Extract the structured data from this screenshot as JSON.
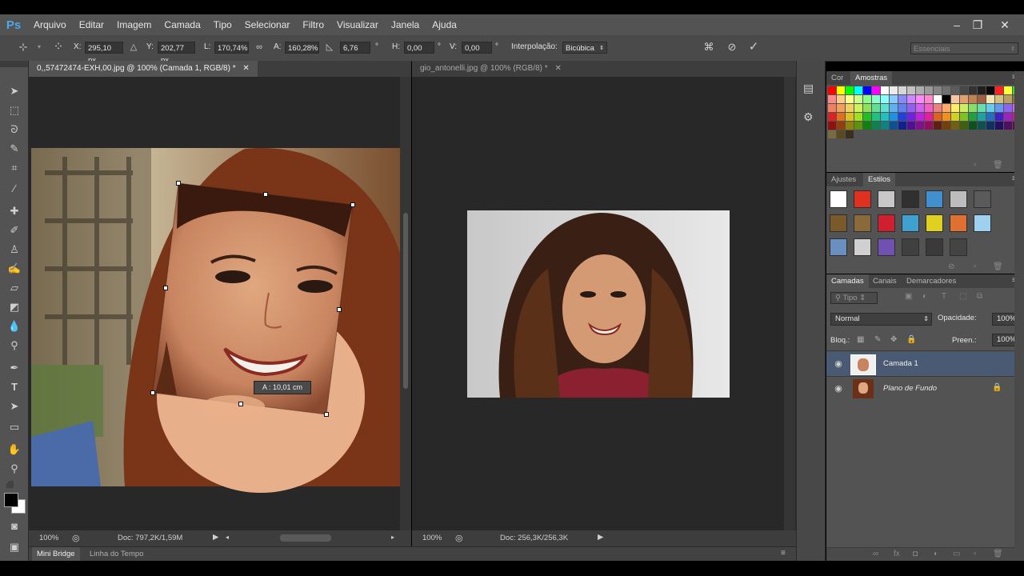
{
  "app": {
    "logo": "Ps"
  },
  "menu": [
    "Arquivo",
    "Editar",
    "Imagem",
    "Camada",
    "Tipo",
    "Selecionar",
    "Filtro",
    "Visualizar",
    "Janela",
    "Ajuda"
  ],
  "window_controls": {
    "minimize": "–",
    "restore": "❐",
    "close": "✕"
  },
  "options": {
    "x_label": "X:",
    "x_value": "295,10 px",
    "y_label": "Y:",
    "y_value": "202,77 px",
    "w_label": "L:",
    "w_value": "170,74%",
    "h_label": "A:",
    "h_value": "160,28%",
    "angle_value": "6,76",
    "hskew_label": "H:",
    "hskew_value": "0,00",
    "vskew_label": "V:",
    "vskew_value": "0,00",
    "degree": "°",
    "interp_label": "Interpolação:",
    "interp_value": "Bicúbica",
    "workspace": "Essenciais"
  },
  "doc1": {
    "tab": "0,,57472474-EXH,00.jpg @ 100% (Camada 1, RGB/8) *",
    "zoom": "100%",
    "doc_info": "Doc: 797,2K/1,59M",
    "transform_tooltip": "A :  10,01 cm"
  },
  "doc2": {
    "tab": "gio_antonelli.jpg @ 100% (RGB/8) *",
    "zoom": "100%",
    "doc_info": "Doc: 256,3K/256,3K"
  },
  "bottom_tabs": {
    "mini_bridge": "Mini Bridge",
    "timeline": "Linha do Tempo"
  },
  "color_panel": {
    "tab_color": "Cor",
    "tab_swatches": "Amostras"
  },
  "styles_panel": {
    "tab_adjust": "Ajustes",
    "tab_styles": "Estilos"
  },
  "layers_panel": {
    "tab_layers": "Camadas",
    "tab_channels": "Canais",
    "tab_paths": "Demarcadores",
    "kind_filter": "Tipo",
    "blend_mode": "Normal",
    "opacity_label": "Opacidade:",
    "opacity_value": "100%",
    "lock_label": "Bloq.:",
    "fill_label": "Preen.:",
    "fill_value": "100%",
    "layers": [
      {
        "name": "Camada 1",
        "selected": true
      },
      {
        "name": "Plano de Fundo",
        "selected": false,
        "locked": true
      }
    ]
  },
  "colors": {
    "accent_ps": "#4ea6e8",
    "selected_layer": "#4a5a72",
    "swatch_rows": [
      [
        "#ff0000",
        "#ffff00",
        "#00ff00",
        "#00ffff",
        "#0000ff",
        "#ff00ff",
        "#ffffff",
        "#ebebeb",
        "#d6d6d6",
        "#c2c2c2",
        "#adadad",
        "#999999",
        "#858585",
        "#707070",
        "#5c5c5c",
        "#474747",
        "#333333",
        "#1f1f1f",
        "#0a0a0a",
        "#ff2222",
        "#ffff33",
        "#33dd33"
      ],
      [
        "#ff8888",
        "#ffcc88",
        "#ffff88",
        "#ccff88",
        "#88ff88",
        "#88ffcc",
        "#88ffff",
        "#88ccff",
        "#8888ff",
        "#cc88ff",
        "#ff88ff",
        "#ff88cc",
        "#ffffff",
        "#000000",
        "#f7c6a0",
        "#e0a070",
        "#c08050",
        "#a06040",
        "#f4e4b0",
        "#d4c080",
        "#b8a060",
        "#8c7040"
      ],
      [
        "#f08060",
        "#f0a060",
        "#f0d060",
        "#d0f060",
        "#90e060",
        "#60e090",
        "#60e0d0",
        "#60b0f0",
        "#6080f0",
        "#9060f0",
        "#d060f0",
        "#f060c0",
        "#f08080",
        "#ffaa66",
        "#ffee66",
        "#ccee66",
        "#88dd66",
        "#66ddaa",
        "#66ccee",
        "#6699ee",
        "#8866ee",
        "#cc66ee"
      ],
      [
        "#e02020",
        "#e07020",
        "#e0c020",
        "#a0e020",
        "#20c020",
        "#20c080",
        "#20c0c0",
        "#2090e0",
        "#2040e0",
        "#7020e0",
        "#c020e0",
        "#e020a0",
        "#e06020",
        "#f09020",
        "#d0d020",
        "#80c020",
        "#20a040",
        "#20a0a0",
        "#2070c0",
        "#4020c0",
        "#a020c0",
        "#c02080"
      ],
      [
        "#901010",
        "#904010",
        "#908010",
        "#609010",
        "#108010",
        "#108050",
        "#108080",
        "#105090",
        "#102090",
        "#501090",
        "#801090",
        "#901060",
        "#602010",
        "#704010",
        "#706010",
        "#406010",
        "#105020",
        "#105050",
        "#103060",
        "#201060",
        "#501060",
        "#601040"
      ],
      [
        "#7a6a40",
        "#5a4a20",
        "#3a3020"
      ]
    ],
    "styles": [
      [
        "#ffffff",
        "#e03020",
        "#c8c8c8",
        "#303030",
        "#4090d0",
        "#bdbdbd",
        "#5a5a5a"
      ],
      [
        "#7a5a2a",
        "#8a6a3a",
        "#d02030",
        "#40a0d0",
        "#e0d020",
        "#e07030",
        "#a0d0f0"
      ],
      [
        "#6a90c0",
        "#d0d0d0",
        "#7050b0",
        "#404040",
        "#3a3a3a",
        "#444444"
      ]
    ]
  }
}
